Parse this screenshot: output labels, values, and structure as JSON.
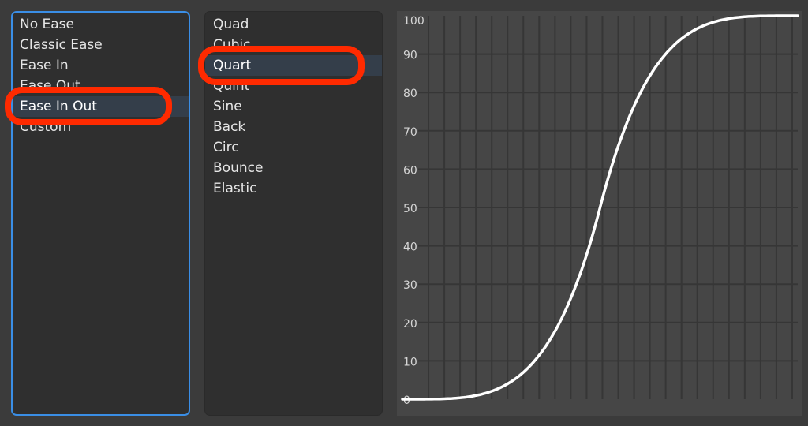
{
  "ease_types": {
    "items": [
      "No Ease",
      "Classic Ease",
      "Ease In",
      "Ease Out",
      "Ease In Out",
      "Custom"
    ],
    "selected": "Ease In Out"
  },
  "ease_functions": {
    "items": [
      "Quad",
      "Cubic",
      "Quart",
      "Quint",
      "Sine",
      "Back",
      "Circ",
      "Bounce",
      "Elastic"
    ],
    "selected": "Quart"
  },
  "colors": {
    "focus_border": "#3a8ee6",
    "highlight_ring": "#ff2a00",
    "selection": "#343e4a",
    "curve": "#ffffff"
  },
  "chart_data": {
    "type": "line",
    "function": "easeInOutQuart",
    "x_range": [
      0,
      100
    ],
    "ylim": [
      0,
      100
    ],
    "y_ticks": [
      "0",
      "10",
      "20",
      "30",
      "40",
      "50",
      "60",
      "70",
      "80",
      "90",
      "100"
    ],
    "grid": true,
    "vertical_grid_divisions": 25
  }
}
